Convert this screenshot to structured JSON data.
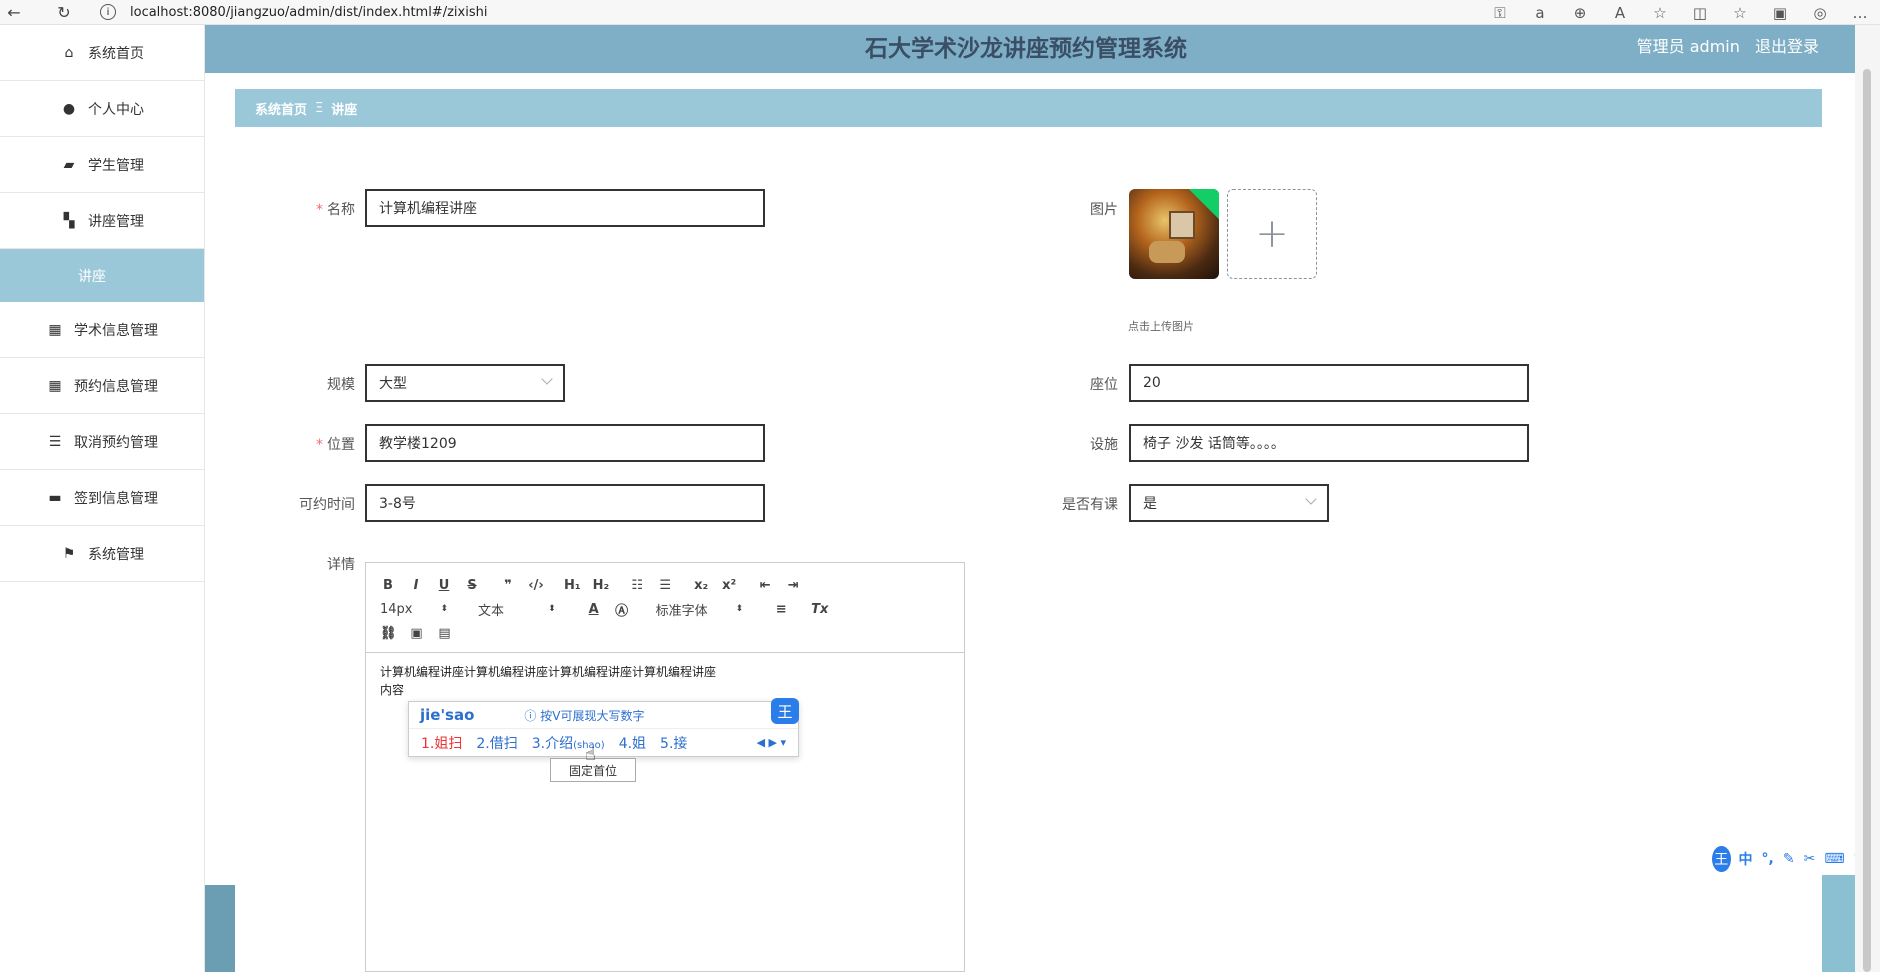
{
  "browser": {
    "url": "localhost:8080/jiangzuo/admin/dist/index.html#/zixishi"
  },
  "sidebar": {
    "items": [
      {
        "label": "系统首页",
        "icon": "home-icon"
      },
      {
        "label": "个人中心",
        "icon": "user-icon"
      },
      {
        "label": "学生管理",
        "icon": "wallet-icon"
      },
      {
        "label": "讲座管理",
        "icon": "ticket-icon"
      },
      {
        "label": "讲座",
        "icon": ""
      },
      {
        "label": "学术信息管理",
        "icon": "grid-icon"
      },
      {
        "label": "预约信息管理",
        "icon": "grid-icon"
      },
      {
        "label": "取消预约管理",
        "icon": "list-icon"
      },
      {
        "label": "签到信息管理",
        "icon": "inbox-icon"
      },
      {
        "label": "系统管理",
        "icon": "flag-icon"
      }
    ]
  },
  "header": {
    "title": "石大学术沙龙讲座预约管理系统",
    "user_role": "管理员 admin",
    "logout": "退出登录"
  },
  "breadcrumb": {
    "home": "系统首页",
    "separator": "Ξ",
    "current": "讲座"
  },
  "form": {
    "name_label": "名称",
    "name_value": "计算机编程讲座",
    "image_label": "图片",
    "upload_tip": "点击上传图片",
    "scale_label": "规模",
    "scale_value": "大型",
    "seats_label": "座位",
    "seats_value": "20",
    "location_label": "位置",
    "location_value": "教学楼1209",
    "facility_label": "设施",
    "facility_value": "椅子 沙发 话筒等。。。。",
    "time_label": "可约时间",
    "time_value": "3-8号",
    "class_label": "是否有课",
    "class_value": "是",
    "detail_label": "详情"
  },
  "editor": {
    "font_size": "14px",
    "text_type": "文本",
    "font_family": "标准字体",
    "content_line1": "计算机编程讲座计算机编程讲座计算机编程讲座计算机编程讲座",
    "content_line2": "内容"
  },
  "ime": {
    "pinyin": "jie'sao",
    "hint": "按V可展现大写数字",
    "candidates": [
      "1.姐扫",
      "2.借扫",
      "3.介绍",
      "4.姐",
      "5.接"
    ],
    "candidate3_note": "(shao)",
    "tooltip": "固定首位",
    "logo": "王",
    "bar_lang": "中"
  }
}
